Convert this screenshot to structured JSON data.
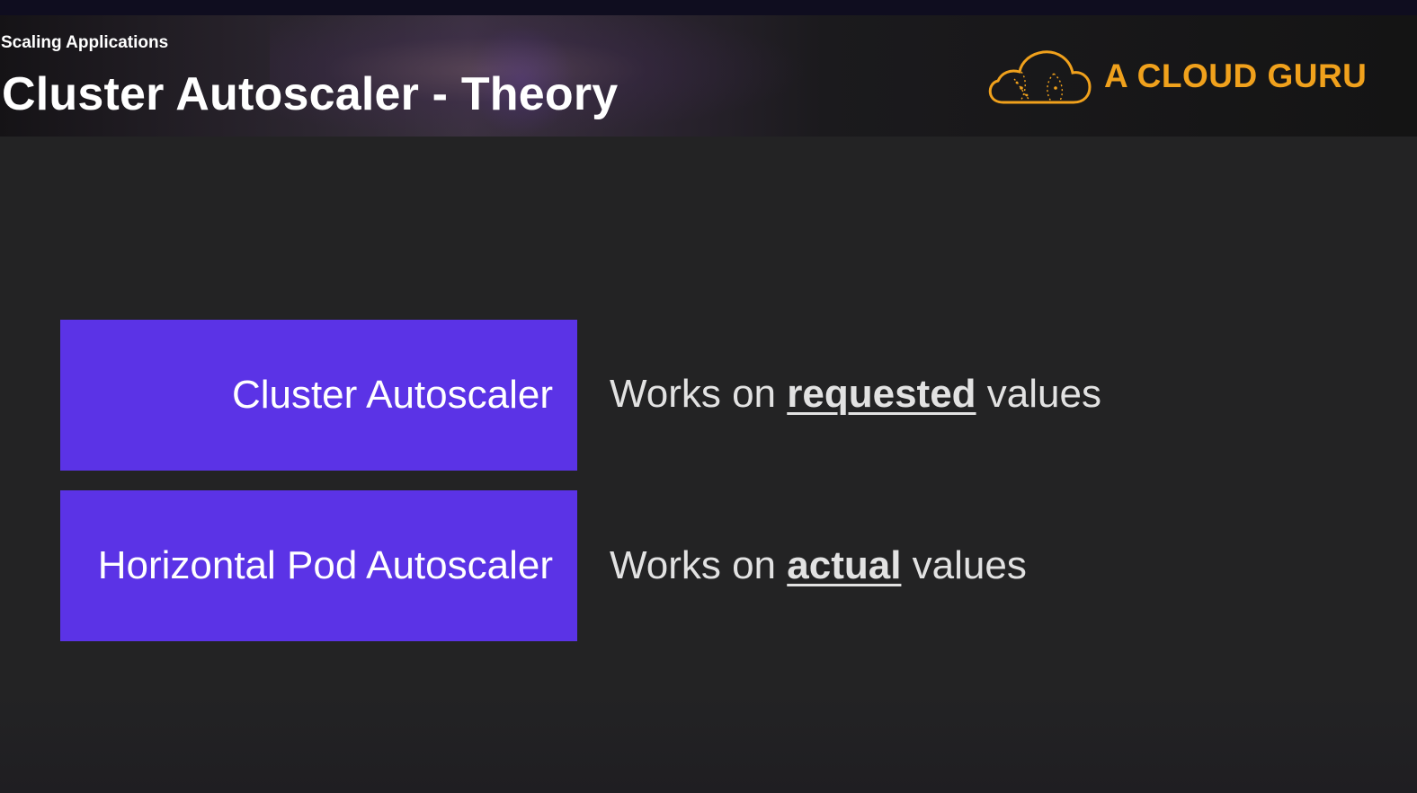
{
  "header": {
    "section_label": "Scaling Applications",
    "title": "Cluster Autoscaler - Theory",
    "brand_name": "A CLOUD GURU",
    "brand_color": "#f0a11c",
    "brand_icon": "cloud-logo-icon"
  },
  "rows": [
    {
      "box_label": "Cluster Autoscaler",
      "desc_prefix": "Works on",
      "desc_emphasis": "requested",
      "desc_suffix": "values"
    },
    {
      "box_label": "Horizontal Pod Autoscaler",
      "desc_prefix": "Works on",
      "desc_emphasis": "actual",
      "desc_suffix": "values"
    }
  ],
  "colors": {
    "box_background": "#5b33e6",
    "slide_background": "#232324",
    "text": "#e2e2e2"
  }
}
